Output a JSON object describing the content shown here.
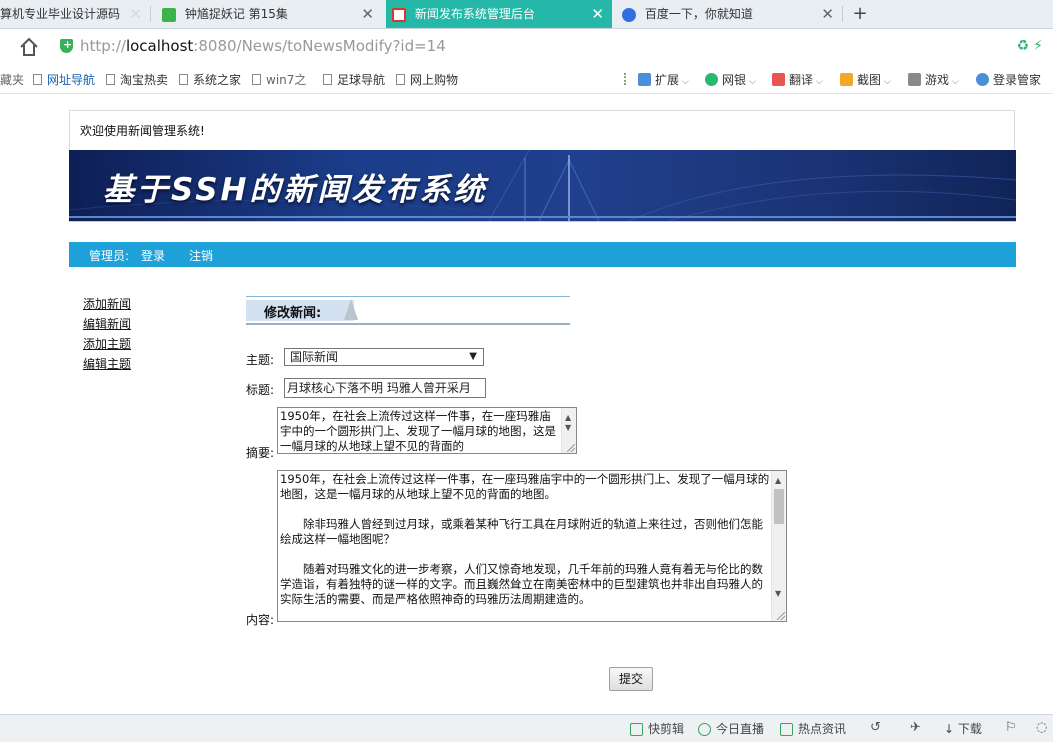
{
  "browser": {
    "tabs": [
      {
        "title": "算机专业毕业设计源码",
        "icon_color": "#e8eef3",
        "active": false
      },
      {
        "title": "钟馗捉妖记 第15集",
        "icon_color": "#3bb34a",
        "active": false
      },
      {
        "title": "新闻发布系统管理后台",
        "icon_color": "#d9372b",
        "active": true
      },
      {
        "title": "百度一下，你就知道",
        "icon_color": "#2f6fe0",
        "active": false
      }
    ],
    "new_tab": "+",
    "close_glyph": "✕",
    "url": {
      "prefix": "http://",
      "host": "localhost",
      "rest": ":8080/News/toNewsModify?id=14"
    },
    "bookmarks": [
      {
        "label": "藏夹",
        "style": "grey"
      },
      {
        "label": "网址导航",
        "style": "blue"
      },
      {
        "label": "淘宝热卖",
        "style": "plain"
      },
      {
        "label": "系统之家",
        "style": "plain"
      },
      {
        "label": "win7之",
        "style": "plain"
      },
      {
        "label": "足球导航",
        "style": "plain"
      },
      {
        "label": "网上购物",
        "style": "plain"
      }
    ],
    "tools": [
      {
        "label": "扩展",
        "icon_color": "#4a8fd9"
      },
      {
        "label": "网银",
        "icon_color": "#2bb673"
      },
      {
        "label": "翻译",
        "icon_color": "#e8554e"
      },
      {
        "label": "截图",
        "icon_color": "#f2a72a"
      },
      {
        "label": "游戏",
        "icon_color": "#8a8a8a"
      },
      {
        "label": "登录管家",
        "icon_color": "#4a8fd9"
      }
    ],
    "status_items": [
      {
        "label": "快剪辑",
        "icon": "play-square-icon"
      },
      {
        "label": "今日直播",
        "icon": "play-circle-icon"
      },
      {
        "label": "热点资讯",
        "icon": "news-icon"
      }
    ],
    "download_label": "下载"
  },
  "page": {
    "welcome": "欢迎使用新闻管理系统!",
    "banner_title": "基于SSH的新闻发布系统",
    "nav": {
      "admin": "管理员:",
      "login": "登录",
      "logout": "注销"
    },
    "sidebar": [
      "添加新闻",
      "编辑新闻",
      "添加主题",
      "编辑主题"
    ],
    "form_title": "修改新闻:",
    "labels": {
      "topic": "主题:",
      "title": "标题:",
      "summary": "摘要:",
      "content": "内容:"
    },
    "topic_selected": "国际新闻",
    "title_value": "月球核心下落不明 玛雅人曾开采月",
    "summary_value": "1950年，在社会上流传过这样一件事，在一座玛雅庙宇中的一个圆形拱门上、发现了一幅月球的地图，这是一幅月球的从地球上望不见的背面的",
    "content_value": "1950年，在社会上流传过这样一件事，在一座玛雅庙宇中的一个圆形拱门上、发现了一幅月球的地图，这是一幅月球的从地球上望不见的背面的地图。\n\n　　除非玛雅人曾经到过月球，或乘着某种飞行工具在月球附近的轨道上来往过，否则他们怎能绘成这样一幅地图呢？\n\n　　随着对玛雅文化的进一步考察，人们又惊奇地发现，几千年前的玛雅人竟有着无与伦比的数学造诣，有着独特的谜一样的文字。而且巍然耸立在南美密林中的巨型建筑也并非出自玛雅人的实际生活的需要、而是严格依照神奇的玛雅历法周期建造的。",
    "submit": "提交"
  }
}
